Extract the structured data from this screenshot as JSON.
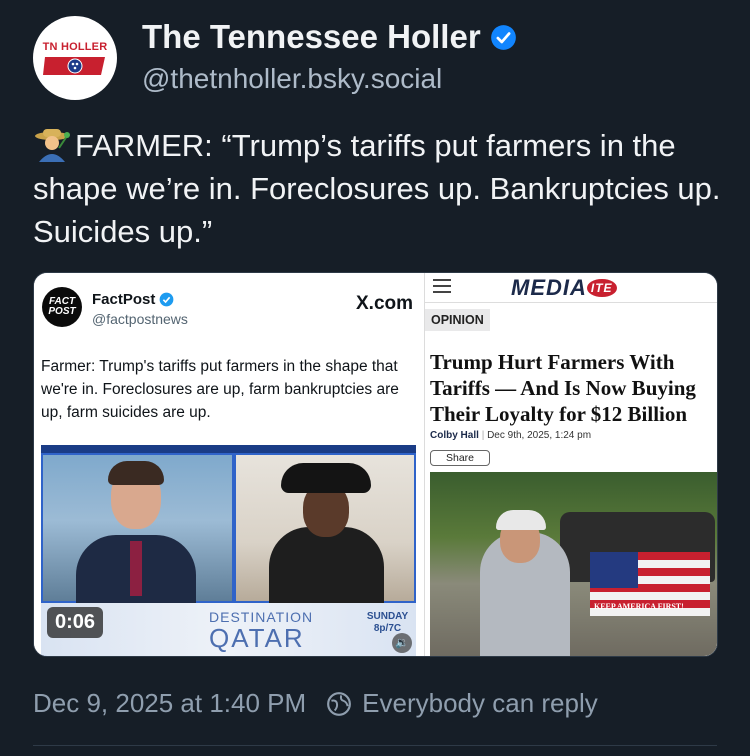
{
  "author": {
    "display_name": "The Tennessee Holler",
    "handle": "@thetnholler.bsky.social",
    "avatar_text": "TN HOLLER",
    "verified": true
  },
  "post": {
    "emoji": "farmer-emoji",
    "text": "FARMER: “Trump’s tariffs put farmers in the shape we’re in. Foreclosures up. Bankruptcies up. Suicides up.”"
  },
  "embed": {
    "left": {
      "logo_text": "FACT POST",
      "name": "FactPost",
      "handle": "@factpostnews",
      "platform": "X.com",
      "body": "Farmer: Trump's tariffs put farmers in the shape that we're in. Foreclosures are up, farm bankruptcies are up, farm suicides are up.",
      "video": {
        "timestamp": "0:06",
        "ticker_top": "DESTINATION",
        "ticker_main": "QATAR",
        "ticker_side": "SUNDAY 8p/7C"
      }
    },
    "right": {
      "site": "MEDIA",
      "site_badge": "ITE",
      "section": "OPINION",
      "headline": "Trump Hurt Farmers With Tariffs — And Is Now Buying Their Loyalty for $12 Billion",
      "author": "Colby Hall",
      "date": "Dec 9th, 2025, 1:24 pm",
      "share_label": "Share",
      "flag_text": "KEEP AMERICA FIRST!"
    }
  },
  "footer": {
    "timestamp": "Dec 9, 2025 at 1:40 PM",
    "reply_setting": "Everybody can reply"
  },
  "colors": {
    "background": "#161e27",
    "text": "#f1f3f5",
    "muted": "#8f9eae",
    "verified_blue": "#1185fe"
  }
}
